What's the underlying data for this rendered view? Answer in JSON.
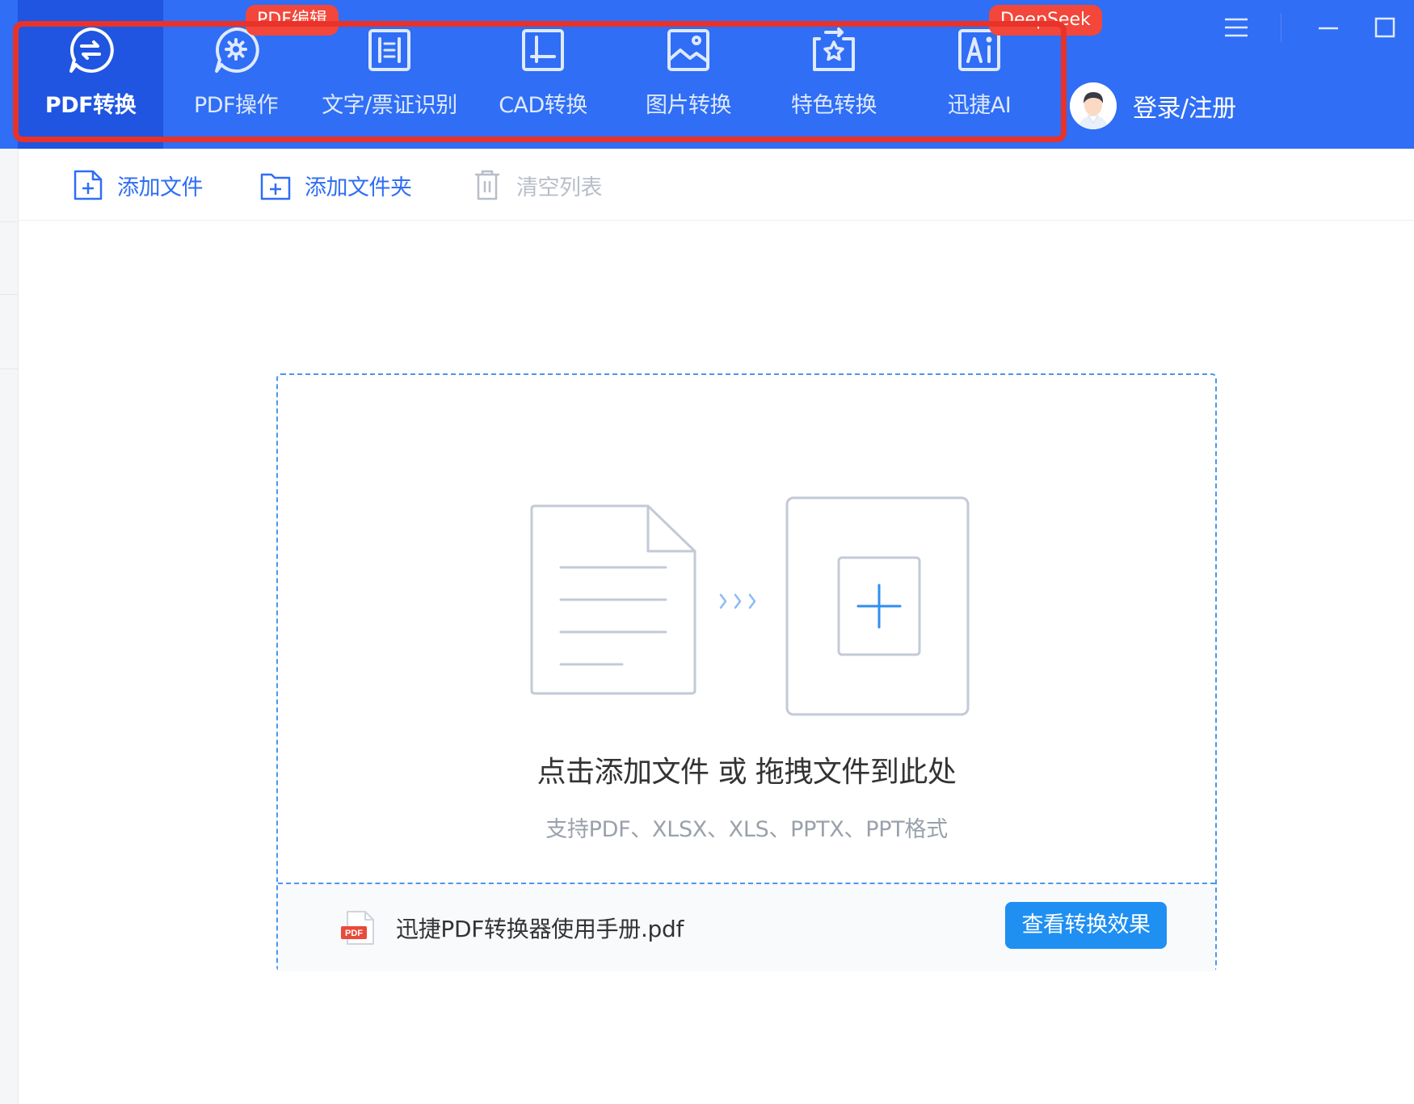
{
  "tabs": [
    {
      "label": "PDF转换",
      "icon": "pdf-convert-icon",
      "active": true
    },
    {
      "label": "PDF操作",
      "icon": "pdf-gear-icon",
      "active": false
    },
    {
      "label": "文字/票证识别",
      "icon": "ocr-scan-icon",
      "active": false
    },
    {
      "label": "CAD转换",
      "icon": "cad-icon",
      "active": false
    },
    {
      "label": "图片转换",
      "icon": "image-icon",
      "active": false
    },
    {
      "label": "特色转换",
      "icon": "star-convert-icon",
      "active": false
    },
    {
      "label": "迅捷AI",
      "icon": "ai-icon",
      "active": false
    }
  ],
  "badges": {
    "pdf_edit": "PDF编辑",
    "deepseek": "DeepSeek"
  },
  "user": {
    "login_label": "登录/注册"
  },
  "toolbar": {
    "add_file": "添加文件",
    "add_folder": "添加文件夹",
    "clear_list": "清空列表"
  },
  "dropzone": {
    "title": "点击添加文件 或 拖拽文件到此处",
    "subtitle": "支持PDF、XLSX、XLS、PPTX、PPT格式",
    "sample_file": "迅捷PDF转换器使用手册.pdf",
    "pdf_icon_text": "PDF",
    "view_button": "查看转换效果"
  },
  "colors": {
    "topbar": "#2f6ef5",
    "active_tab": "#1f55e0",
    "badge": "#f2473a",
    "highlight": "#e8322a",
    "accent": "#1f8ff2",
    "dashed_border": "#4b96ee"
  }
}
